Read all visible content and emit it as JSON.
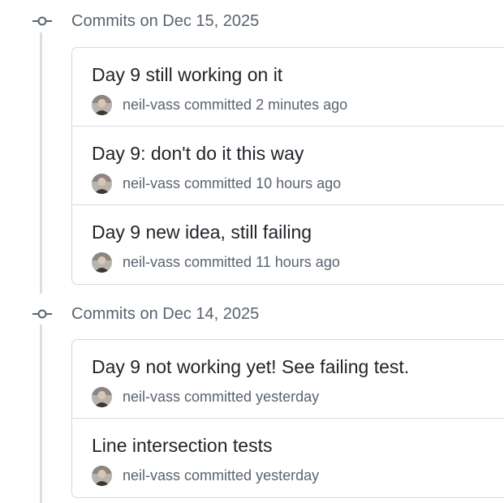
{
  "groups": [
    {
      "title": "Commits on Dec 15, 2025",
      "commits": [
        {
          "message": "Day 9 still working on it",
          "author": "neil-vass",
          "action": "committed",
          "time": "2 minutes ago"
        },
        {
          "message": "Day 9: don't do it this way",
          "author": "neil-vass",
          "action": "committed",
          "time": "10 hours ago"
        },
        {
          "message": "Day 9 new idea, still failing",
          "author": "neil-vass",
          "action": "committed",
          "time": "11 hours ago"
        }
      ]
    },
    {
      "title": "Commits on Dec 14, 2025",
      "commits": [
        {
          "message": "Day 9 not working yet! See failing test.",
          "author": "neil-vass",
          "action": "committed",
          "time": "yesterday"
        },
        {
          "message": "Line intersection tests",
          "author": "neil-vass",
          "action": "committed",
          "time": "yesterday"
        }
      ]
    }
  ],
  "icons": {
    "group_marker": "git-commit-icon",
    "author_avatar": "avatar-icon"
  },
  "colors": {
    "text_primary": "#1f2328",
    "text_muted": "#59636e",
    "border": "#d1d9e0",
    "timeline": "#d8dee4"
  }
}
